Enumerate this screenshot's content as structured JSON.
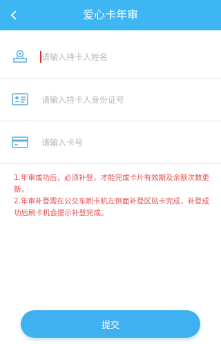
{
  "header": {
    "title": "爱心卡年审",
    "back_icon": "chevron-left-icon"
  },
  "form": {
    "name_placeholder": "请输入持卡人姓名",
    "id_placeholder": "请输入持卡人身份证号",
    "card_placeholder": "请输入卡号",
    "name_icon": "user-stamp-icon",
    "id_icon": "id-card-icon",
    "card_icon": "bank-card-icon"
  },
  "notice": {
    "line1": "1.年审成功后，必须补登，才能完成卡片有效期及余额次数更新。",
    "line2": "2.年审补登需在公交车刷卡机左侧面补登区贴卡完成，补登成功后刷卡机会提示补登完成。"
  },
  "submit_label": "提交",
  "colors": {
    "header_bg": "#3eb6f4",
    "button_bg": "#3fb1f1",
    "notice_text": "#e54f4f",
    "icon": "#5aaee0"
  }
}
